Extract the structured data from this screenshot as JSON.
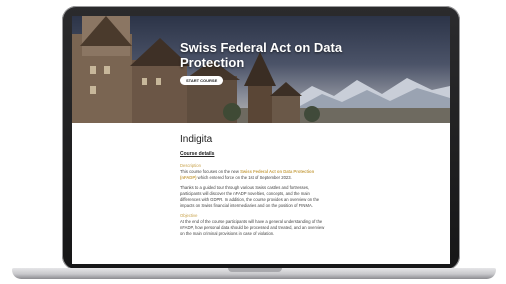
{
  "hero": {
    "title": "Swiss Federal Act on Data Protection",
    "button_label": "START COURSE"
  },
  "brand": "Indigita",
  "course_details": {
    "heading": "Course details",
    "description_label": "Description",
    "description_p1_lead": "This course focuses on the new ",
    "description_p1_highlight": "Swiss Federal Act on Data Protection (nFADP)",
    "description_p1_tail": " which entered force on the 1st of September 2023.",
    "description_p2": "Thanks to a guided tour through various Swiss castles and fortresses, participants will discover the nFADP novelties, concepts, and the main differences with GDPR. In addition, the course provides an overview on the impacts on Swiss financial intermediaries and on the position of FINMA.",
    "objective_label": "Objective",
    "objective_p1": "At the end of the course participants will have a general understanding of the nFADP, how personal data should be processed and treated, and an overview on the main criminal provisions in case of violation."
  },
  "colors": {
    "accent": "#c8a24a",
    "frame": "#1f1f21"
  }
}
